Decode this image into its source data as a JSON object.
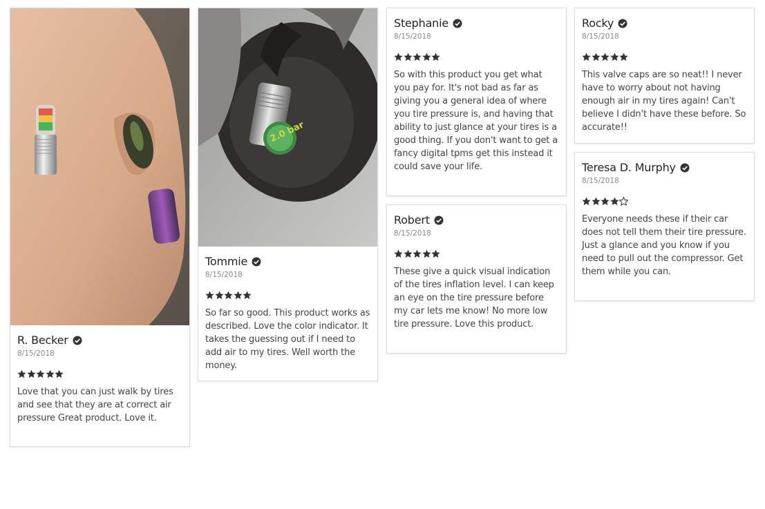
{
  "reviews": [
    {
      "name": "R. Becker",
      "date": "8/15/2018",
      "rating": 5,
      "text": "Love that you can just walk by tires and see that they are at correct air pressure Great product. Love it.",
      "has_photo": true
    },
    {
      "name": "Tommie",
      "date": "8/15/2018",
      "rating": 5,
      "text": "So far so good. This product works as described. Love the color indicator. It takes the guessing out if I need to add air to my tires. Well worth the money.",
      "has_photo": true,
      "photo_cap_label": "2.0 bar"
    },
    {
      "name": "Stephanie",
      "date": "8/15/2018",
      "rating": 5,
      "text": "So with this product you get what you pay for. It's not bad as far as giving you a general idea of where you tire pressure is, and having that ability to just glance at your tires is a good thing. If you don't want to get a fancy digital tpms get this instead it could save your life.",
      "has_photo": false
    },
    {
      "name": "Robert",
      "date": "8/15/2018",
      "rating": 5,
      "text": "These give a quick visual indication of the tires inflation level. I can keep an eye on the tire pressure before my car lets me know! No more low tire pressure. Love this product.",
      "has_photo": false
    },
    {
      "name": "Rocky",
      "date": "8/15/2018",
      "rating": 5,
      "text": "This valve caps are so neat!! I never have to worry about not having enough air in my tires again! Can't believe I didn't have these before. So accurate!!",
      "has_photo": false
    },
    {
      "name": "Teresa D. Murphy",
      "date": "8/15/2018",
      "rating": 4,
      "text": "Everyone needs these if their car does not tell them their tire pressure. Just a glance and you know if you need to pull out the compressor. Get them while you can.",
      "has_photo": false
    }
  ],
  "icons": {
    "verified": "check-circle-icon",
    "star_full": "star-icon",
    "star_empty": "star-outline-icon"
  },
  "colors": {
    "star": "#333333",
    "verified": "#333333",
    "card_border": "#dcdcdc"
  }
}
